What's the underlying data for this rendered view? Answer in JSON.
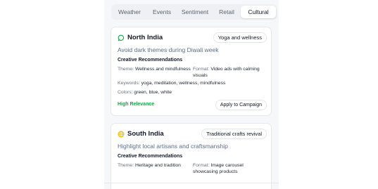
{
  "tabs": [
    {
      "label": "Weather",
      "active": false
    },
    {
      "label": "Events",
      "active": false
    },
    {
      "label": "Sentiment",
      "active": false
    },
    {
      "label": "Retail",
      "active": false
    },
    {
      "label": "Cultural",
      "active": true
    }
  ],
  "cards": [
    {
      "region": "North India",
      "region_icon": "chat-bubble-icon",
      "region_icon_color": "#16a34a",
      "tag": "Yoga and wellness",
      "headline": "Avoid dark themes during Diwali week",
      "section_title": "Creative Recommendations",
      "theme_key": "Theme:",
      "theme_value": "Wellness and mindfulness",
      "format_key": "Format:",
      "format_value": "Video ads with calming visuals",
      "keywords_key": "Keywords:",
      "keywords_value": "yoga, meditation, wellness, mindfulness",
      "colors_key": "Colors:",
      "colors_value": "green, blue, white",
      "relevance": "High Relevance",
      "relevance_color": "#16a34a",
      "action": "Apply to Campaign"
    },
    {
      "region": "South India",
      "region_icon": "globe-icon",
      "region_icon_color": "#eab308",
      "tag": "Traditional crafts revival",
      "headline": "Highlight local artisans and craftsmanship",
      "section_title": "Creative Recommendations",
      "theme_key": "Theme:",
      "theme_value": "Heritage and tradition",
      "format_key": "Format:",
      "format_value": "Image carousel showcasing products"
    }
  ]
}
